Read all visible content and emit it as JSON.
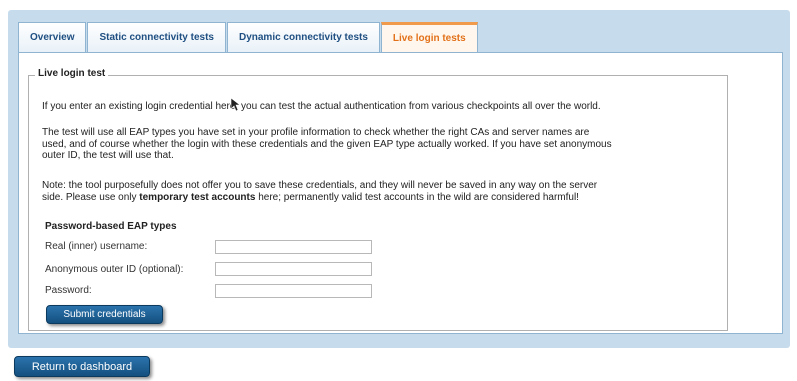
{
  "tabs": [
    {
      "label": "Overview"
    },
    {
      "label": "Static connectivity tests"
    },
    {
      "label": "Dynamic connectivity tests"
    },
    {
      "label": "Live login tests"
    }
  ],
  "active_tab": "Live login tests",
  "section": {
    "legend": "Live login test",
    "intro": "If you enter an existing login credential here, you can test the actual authentication from various checkpoints all over the world.",
    "eap_line1": "The test will use all EAP types you have set in your profile information to check whether the right CAs and server names are",
    "eap_line2": "used, and of course whether the login with these credentials and the given EAP type actually worked. If you have set anonymous",
    "eap_line3": "outer ID, the test will use that.",
    "note_line1": "Note: the tool purposefully does not offer you to save these credentials, and they will never be saved in any way on the server",
    "note_line2_pre": "side. Please use only ",
    "note_line2_bold": "temporary test accounts",
    "note_line2_post": " here; permanently valid test accounts in the wild are considered harmful!"
  },
  "form": {
    "heading": "Password-based EAP types",
    "username_label": "Real (inner) username:",
    "username_value": "",
    "outer_id_label": "Anonymous outer ID (optional):",
    "outer_id_value": "",
    "password_label": "Password:",
    "password_value": "",
    "submit_label": "Submit credentials"
  },
  "footer": {
    "return_label": "Return to dashboard"
  },
  "colors": {
    "frame": "#c6dced",
    "tab_text": "#1f4f82",
    "active_tab_text": "#e2711a",
    "button": "#1a5d92"
  },
  "icons": {
    "cursor": "mouse-pointer-icon"
  }
}
